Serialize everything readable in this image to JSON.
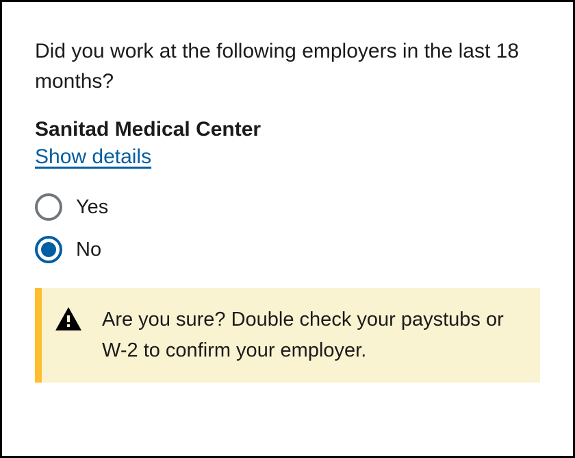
{
  "question": "Did you work at the following employers in the last 18 months?",
  "employer": {
    "name": "Sanitad Medical Center",
    "show_details_label": "Show details"
  },
  "options": {
    "yes_label": "Yes",
    "no_label": "No",
    "selected": "no"
  },
  "alert": {
    "message": "Are you sure? Double check your paystubs or W-2 to confirm your employer."
  }
}
